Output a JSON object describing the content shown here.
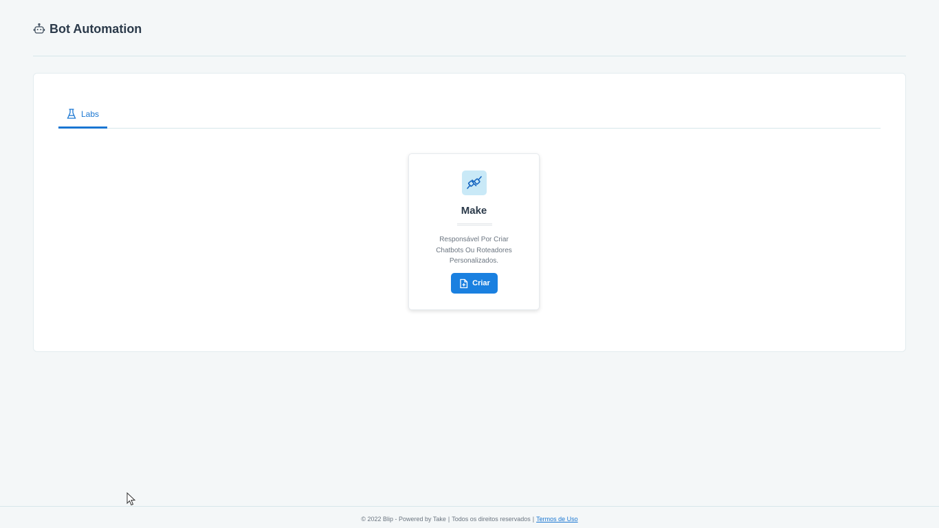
{
  "header": {
    "icon": "robot-icon",
    "title": "Bot Automation"
  },
  "tabs": [
    {
      "icon": "flask-icon",
      "label": "Labs",
      "active": true
    }
  ],
  "cards": [
    {
      "icon": "plug-icon",
      "title": "Make",
      "description": "Responsável Por Criar Chatbots Ou Roteadores Personalizados.",
      "button": {
        "icon": "file-plus-icon",
        "label": "Criar"
      }
    }
  ],
  "footer": {
    "copyright": "© 2022 Blip - Powered by Take",
    "rights": "Todos os direitos reservados",
    "terms_link": "Termos de Uso"
  },
  "colors": {
    "accent": "#1976d2",
    "button": "#1a80e0",
    "icon_bg": "#c9e9f7",
    "background": "#f4f7f8"
  }
}
